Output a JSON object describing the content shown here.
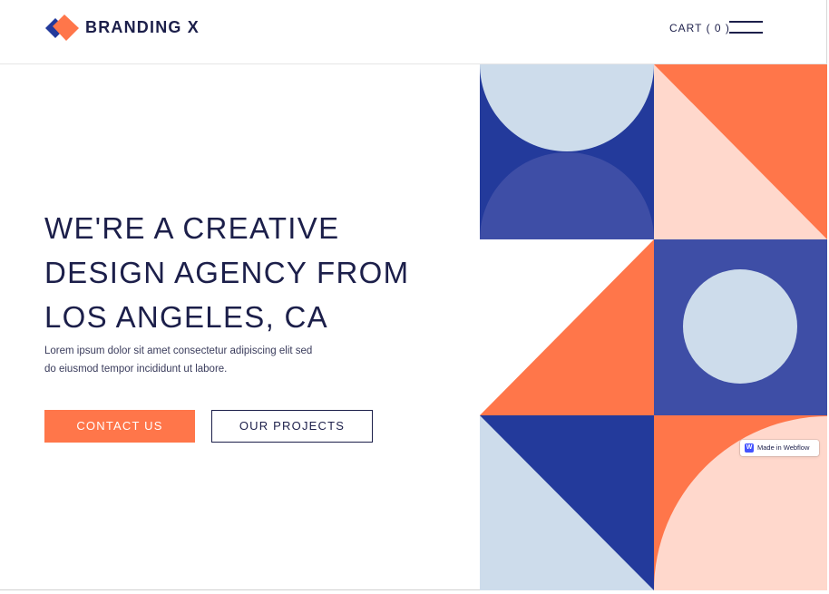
{
  "header": {
    "brand": "BRANDING X",
    "cart_label": "CART ( 0 )"
  },
  "hero": {
    "headline_lines": [
      "WE'RE A CREATIVE",
      "DESIGN AGENCY FROM",
      "LOS ANGELES, CA"
    ],
    "description_lines": [
      "Lorem ipsum dolor sit amet consectetur adipiscing elit sed",
      "do eiusmod tempor incididunt ut labore."
    ],
    "primary_button": "CONTACT US",
    "secondary_button": "OUR PROJECTS"
  },
  "badge": {
    "logo_letter": "W",
    "label": "Made in Webflow"
  },
  "icons": {
    "logo": "diamond-logo-icon",
    "menu": "hamburger-menu-icon",
    "badge_logo": "webflow-icon"
  },
  "colors": {
    "navy": "#1c1f4a",
    "orange": "#ff764a",
    "blue": "#233a9b",
    "mid_blue": "#3e4ea6",
    "light_blue": "#cddceb",
    "peach": "#ffd8cc"
  }
}
